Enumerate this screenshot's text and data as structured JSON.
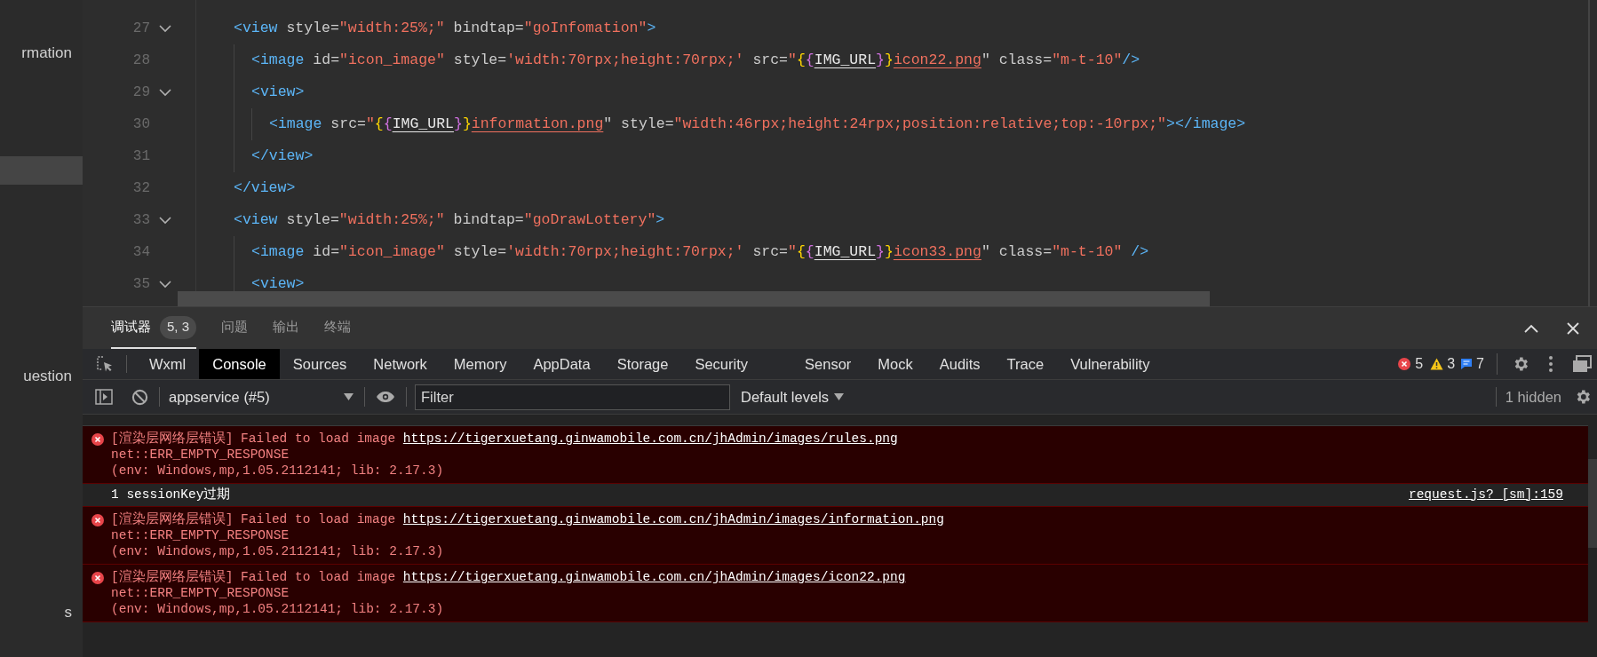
{
  "sidebar": {
    "items": [
      {
        "label": "rmation",
        "selected": false
      },
      {
        "selected": true
      },
      {
        "label": "uestion",
        "selected": false
      },
      {
        "label": "s",
        "selected": false
      }
    ]
  },
  "editor": {
    "lines": [
      {
        "number": "27",
        "foldable": true,
        "tokens": [
          {
            "kind": "tag",
            "text": "<view"
          },
          {
            "kind": "attr",
            "text": " style="
          },
          {
            "kind": "str",
            "text": "\"width:25%;\""
          },
          {
            "kind": "attr",
            "text": " bindtap="
          },
          {
            "kind": "str",
            "text": "\"goInfomation\""
          },
          {
            "kind": "tag",
            "text": ">"
          }
        ],
        "children": [
          {
            "number": "28",
            "foldable": false,
            "tokens": [
              {
                "kind": "tag",
                "text": "<image"
              },
              {
                "kind": "attr",
                "text": " id="
              },
              {
                "kind": "str",
                "text": "\"icon_image\""
              },
              {
                "kind": "attr",
                "text": " style="
              },
              {
                "kind": "str",
                "text": "'width:70rpx;height:70rpx;'"
              },
              {
                "kind": "attr",
                "text": " src="
              },
              {
                "kind": "str",
                "text": "\""
              },
              {
                "kind": "brace",
                "text": "{"
              },
              {
                "kind": "brace2",
                "text": "{"
              },
              {
                "kind": "var",
                "text": "IMG_URL"
              },
              {
                "kind": "brace2",
                "text": "}"
              },
              {
                "kind": "brace",
                "text": "}"
              },
              {
                "kind": "link",
                "text": "icon22.png"
              },
              {
                "kind": "attr",
                "text": "\""
              },
              {
                "kind": "attr",
                "text": " class="
              },
              {
                "kind": "str",
                "text": "\"m-t-10\""
              },
              {
                "kind": "tag",
                "text": "/>"
              }
            ]
          },
          {
            "number": "29",
            "foldable": true,
            "tokens": [
              {
                "kind": "tag",
                "text": "<view>"
              }
            ],
            "children": [
              {
                "number": "30",
                "foldable": false,
                "tokens": [
                  {
                    "kind": "tag",
                    "text": "<image"
                  },
                  {
                    "kind": "attr",
                    "text": " src="
                  },
                  {
                    "kind": "str",
                    "text": "\""
                  },
                  {
                    "kind": "brace",
                    "text": "{"
                  },
                  {
                    "kind": "brace2",
                    "text": "{"
                  },
                  {
                    "kind": "var",
                    "text": "IMG_URL"
                  },
                  {
                    "kind": "brace2",
                    "text": "}"
                  },
                  {
                    "kind": "brace",
                    "text": "}"
                  },
                  {
                    "kind": "link",
                    "text": "information.png"
                  },
                  {
                    "kind": "attr",
                    "text": "\""
                  },
                  {
                    "kind": "attr",
                    "text": " style="
                  },
                  {
                    "kind": "str",
                    "text": "\"width:46rpx;height:24rpx;position:relative;top:-10rpx;\""
                  },
                  {
                    "kind": "tag",
                    "text": "></image>"
                  }
                ]
              }
            ]
          },
          {
            "number": "31",
            "foldable": false,
            "tokens": [
              {
                "kind": "tag",
                "text": "</view>"
              }
            ]
          }
        ]
      },
      {
        "number": "32",
        "foldable": false,
        "tokens": [
          {
            "kind": "tag",
            "text": "</view>"
          }
        ]
      },
      {
        "number": "33",
        "foldable": true,
        "tokens": [
          {
            "kind": "tag",
            "text": "<view"
          },
          {
            "kind": "attr",
            "text": " style="
          },
          {
            "kind": "str",
            "text": "\"width:25%;\""
          },
          {
            "kind": "attr",
            "text": " bindtap="
          },
          {
            "kind": "str",
            "text": "\"goDrawLottery\""
          },
          {
            "kind": "tag",
            "text": ">"
          }
        ],
        "children": [
          {
            "number": "34",
            "foldable": false,
            "tokens": [
              {
                "kind": "tag",
                "text": "<image"
              },
              {
                "kind": "attr",
                "text": " id="
              },
              {
                "kind": "str",
                "text": "\"icon_image\""
              },
              {
                "kind": "attr",
                "text": " style="
              },
              {
                "kind": "str",
                "text": "'width:70rpx;height:70rpx;'"
              },
              {
                "kind": "attr",
                "text": " src="
              },
              {
                "kind": "str",
                "text": "\""
              },
              {
                "kind": "brace",
                "text": "{"
              },
              {
                "kind": "brace2",
                "text": "{"
              },
              {
                "kind": "var",
                "text": "IMG_URL"
              },
              {
                "kind": "brace2",
                "text": "}"
              },
              {
                "kind": "brace",
                "text": "}"
              },
              {
                "kind": "link",
                "text": "icon33.png"
              },
              {
                "kind": "attr",
                "text": "\""
              },
              {
                "kind": "attr",
                "text": " class="
              },
              {
                "kind": "str",
                "text": "\"m-t-10\""
              },
              {
                "kind": "tag",
                "text": " />"
              }
            ]
          },
          {
            "number": "35",
            "foldable": true,
            "tokens": [
              {
                "kind": "tag",
                "text": "<view>"
              }
            ]
          }
        ]
      }
    ]
  },
  "panel_tabs": [
    {
      "label": "调试器",
      "selected": true,
      "badge": "5, 3"
    },
    {
      "label": "问题",
      "selected": false
    },
    {
      "label": "输出",
      "selected": false
    },
    {
      "label": "终端",
      "selected": false
    }
  ],
  "devtools_tabs": [
    {
      "label": "Wxml",
      "selected": false
    },
    {
      "label": "Console",
      "selected": true
    },
    {
      "label": "Sources",
      "selected": false
    },
    {
      "label": "Network",
      "selected": false
    },
    {
      "label": "Memory",
      "selected": false
    },
    {
      "label": "AppData",
      "selected": false
    },
    {
      "label": "Storage",
      "selected": false
    },
    {
      "label": "Security",
      "selected": false
    },
    {
      "label": "Sensor",
      "selected": false
    },
    {
      "label": "Mock",
      "selected": false
    },
    {
      "label": "Audits",
      "selected": false
    },
    {
      "label": "Trace",
      "selected": false
    },
    {
      "label": "Vulnerability",
      "selected": false
    }
  ],
  "counts": {
    "errors": "5",
    "warnings": "3",
    "infos": "7"
  },
  "console_toolbar": {
    "context": "appservice (#5)",
    "filter_placeholder": "Filter",
    "levels": "Default levels",
    "hidden": "1 hidden"
  },
  "messages": [
    {
      "kind": "error",
      "text": "[渲染层网络层错误] Failed to load image ",
      "link": "https://tigerxuetang.ginwamobile.com.cn/jhAdmin/images/rules.png",
      "details": [
        "net::ERR_EMPTY_RESPONSE",
        "(env: Windows,mp,1.05.2112141; lib: 2.17.3)"
      ]
    },
    {
      "kind": "log",
      "text": "1 sessionKey过期",
      "source": "request.js? [sm]:159"
    },
    {
      "kind": "error",
      "text": "[渲染层网络层错误] Failed to load image ",
      "link": "https://tigerxuetang.ginwamobile.com.cn/jhAdmin/images/information.png",
      "details": [
        "net::ERR_EMPTY_RESPONSE",
        "(env: Windows,mp,1.05.2112141; lib: 2.17.3)"
      ]
    },
    {
      "kind": "error",
      "text": "[渲染层网络层错误] Failed to load image ",
      "link": "https://tigerxuetang.ginwamobile.com.cn/jhAdmin/images/icon22.png",
      "details": [
        "net::ERR_EMPTY_RESPONSE",
        "(env: Windows,mp,1.05.2112141; lib: 2.17.3)"
      ]
    }
  ]
}
